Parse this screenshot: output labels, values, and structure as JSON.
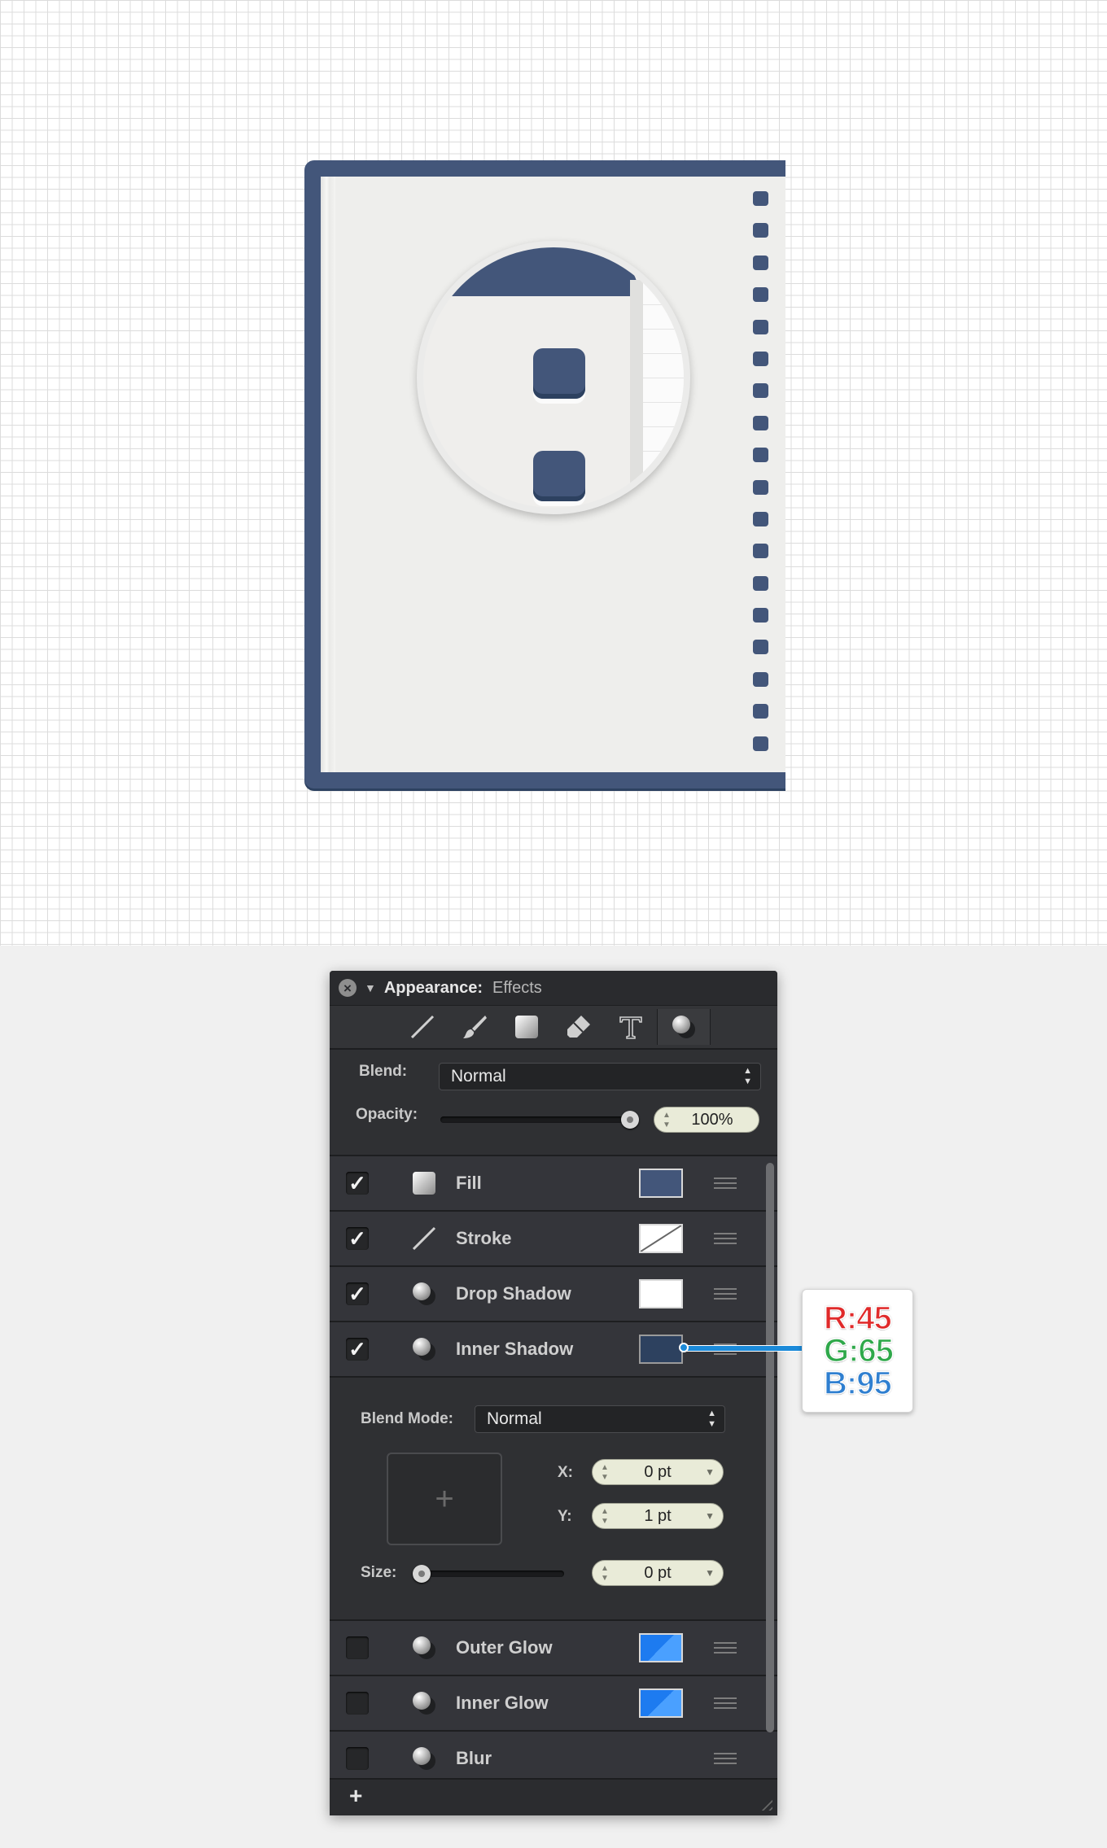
{
  "panel": {
    "title": "Appearance:",
    "subtitle": "Effects",
    "close_icon": "close-icon",
    "toolbar": [
      {
        "icon": "stroke-tool-icon",
        "glyph": "╱"
      },
      {
        "icon": "brush-tool-icon",
        "glyph": "🖌"
      },
      {
        "icon": "fill-tool-icon",
        "glyph": "■"
      },
      {
        "icon": "eraser-tool-icon",
        "glyph": "◆"
      },
      {
        "icon": "text-tool-icon",
        "glyph": "T"
      },
      {
        "icon": "effects-tool-icon",
        "glyph": "●"
      }
    ],
    "blend_label": "Blend:",
    "blend_value": "Normal",
    "opacity_label": "Opacity:",
    "opacity_value": "100%",
    "opacity_fraction": 1.0,
    "effects": [
      {
        "label": "Fill",
        "checked": true,
        "check": "✓",
        "swatch": "#43567a"
      },
      {
        "label": "Stroke",
        "checked": true,
        "check": "✓",
        "swatch": "none"
      },
      {
        "label": "Drop Shadow",
        "checked": true,
        "check": "✓",
        "swatch": "#ffffff"
      },
      {
        "label": "Inner Shadow",
        "checked": true,
        "check": "✓",
        "swatch": "#2d415f"
      },
      {
        "label": "Outer Glow",
        "checked": false,
        "check": "",
        "swatch": "#2a8cff"
      },
      {
        "label": "Inner Glow",
        "checked": false,
        "check": "",
        "swatch": "#2a8cff"
      },
      {
        "label": "Blur",
        "checked": false,
        "check": "",
        "swatch": "none"
      }
    ],
    "inner_shadow": {
      "blend_mode_label": "Blend Mode:",
      "blend_mode_value": "Normal",
      "x_label": "X:",
      "x_value": "0 pt",
      "y_label": "Y:",
      "y_value": "1 pt",
      "size_label": "Size:",
      "size_value": "0 pt",
      "size_fraction": 0.0,
      "preview_glyph": "+"
    },
    "add_label": "+"
  },
  "callout": {
    "r": "R:45",
    "g": "G:65",
    "b": "B:95",
    "r_color": "#e02a2a",
    "g_color": "#2fa84a",
    "b_color": "#2f7fd0"
  },
  "artwork": {
    "notebook_color": "#43567a",
    "page_color": "#eeeeec"
  }
}
